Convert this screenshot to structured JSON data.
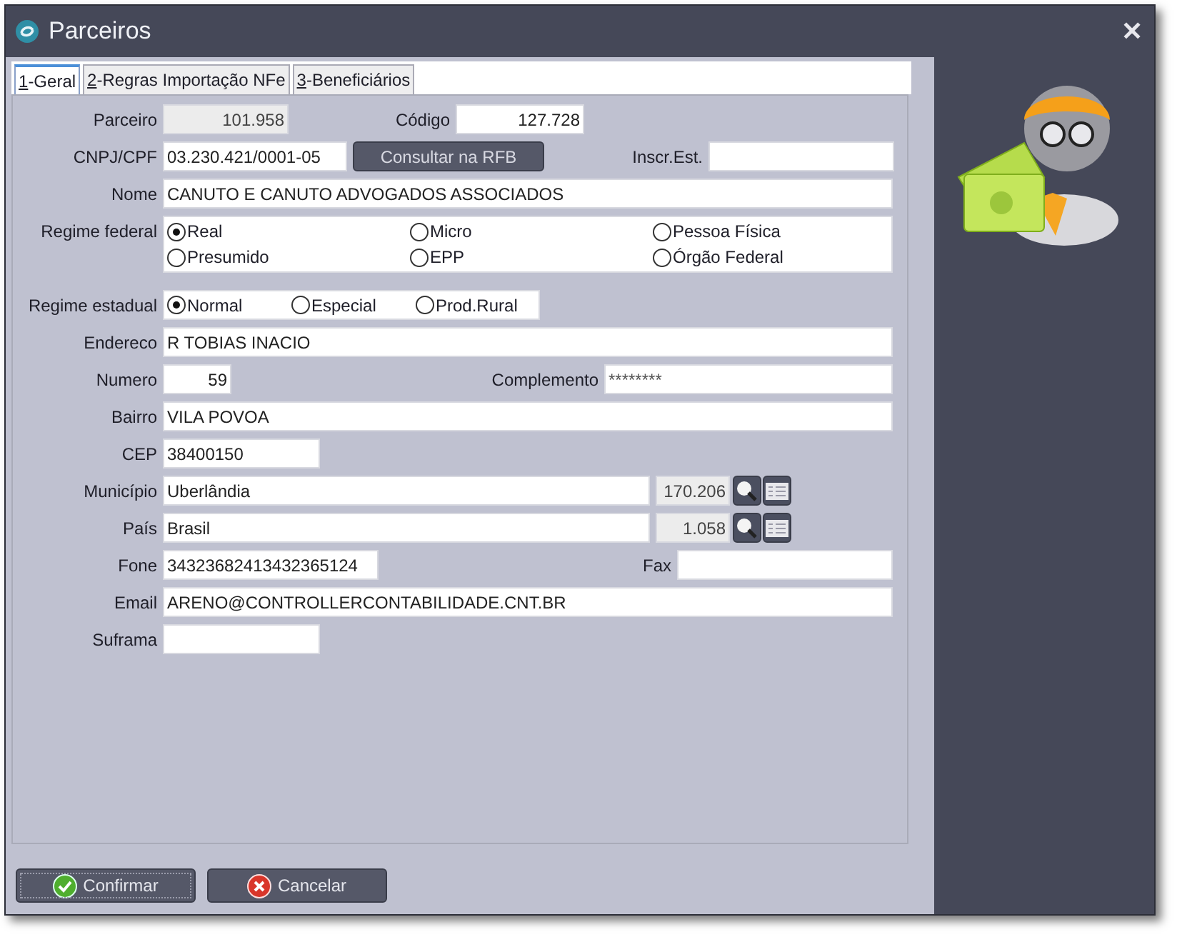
{
  "window": {
    "title": "Parceiros",
    "close": "✕"
  },
  "tabs": [
    {
      "label": "1-Geral",
      "selected": true
    },
    {
      "label": "2-Regras Importação NFe",
      "selected": false
    },
    {
      "label": "3-Beneficiários",
      "selected": false
    }
  ],
  "form": {
    "parceiro": {
      "label": "Parceiro",
      "value": "101.958",
      "disabled": true
    },
    "codigo": {
      "label": "Código",
      "value": "127.728",
      "disabled": false
    },
    "cnpj": {
      "label": "CNPJ/CPF",
      "value": "03.230.421/0001-05",
      "disabled": false
    },
    "consult_button": "Consultar na RFB",
    "inscr": {
      "label": "Inscr.Est.",
      "disabled": false
    },
    "nome": {
      "label": "Nome",
      "value": "CANUTO E CANUTO ADVOGADOS ASSOCIADOS",
      "disabled": false
    },
    "regime_federal": {
      "label": "Regime federal",
      "options": [
        {
          "label": "Real",
          "selected": true
        },
        {
          "label": "Micro",
          "selected": false
        },
        {
          "label": "Pessoa Física",
          "selected": false
        },
        {
          "label": "Presumido",
          "selected": false
        },
        {
          "label": "EPP",
          "selected": false
        },
        {
          "label": "Órgão Federal",
          "selected": false
        }
      ]
    },
    "regime_estadual": {
      "label": "Regime estadual",
      "options": [
        {
          "label": "Normal",
          "selected": true
        },
        {
          "label": "Especial",
          "selected": false
        },
        {
          "label": "Prod.Rural",
          "selected": false
        }
      ]
    },
    "endereco": {
      "label": "Endereco",
      "value": "R TOBIAS INACIO",
      "disabled": false
    },
    "numero": {
      "label": "Numero",
      "value": "59",
      "disabled": false
    },
    "complemento": {
      "label": "Complemento",
      "value": "********",
      "disabled": false
    },
    "bairro": {
      "label": "Bairro",
      "value": "VILA POVOA",
      "disabled": false
    },
    "cep": {
      "label": "CEP",
      "value": "38400150",
      "disabled": false
    },
    "municipio": {
      "label": "Município",
      "value": "Uberlândia",
      "disabled": false
    },
    "municipio_code": {
      "value": "170.206",
      "disabled": true
    },
    "pais": {
      "label": "País",
      "value": "Brasil",
      "disabled": false
    },
    "pais_code": {
      "value": "1.058",
      "disabled": true
    },
    "fone": {
      "label": "Fone",
      "value": "34323682413432365124",
      "disabled": false
    },
    "fax": {
      "label": "Fax",
      "disabled": false
    },
    "email": {
      "label": "Email",
      "value": "ARENO@CONTROLLERCONTABILIDADE.CNT.BR",
      "disabled": false
    },
    "suframa": {
      "label": "Suframa",
      "disabled": false
    }
  },
  "buttons": [
    {
      "kind": "confirm",
      "label": "Confirmar"
    },
    {
      "kind": "cancel",
      "label": "Cancelar"
    }
  ]
}
